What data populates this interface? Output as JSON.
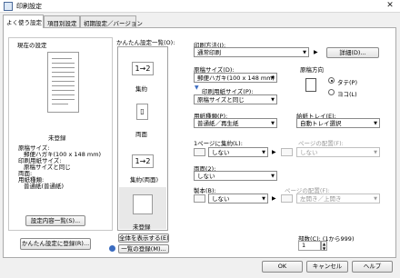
{
  "window": {
    "title": "印刷設定",
    "close_glyph": "✕"
  },
  "tabs": [
    {
      "label": "よく使う設定"
    },
    {
      "label": "項目別設定"
    },
    {
      "label": "初期設定／バージョン"
    }
  ],
  "current": {
    "heading": "現在の設定",
    "name": "未登録",
    "summary": [
      "原稿サイズ:",
      "郵便ハガキ(100 x 148 mm)",
      "印刷用紙サイズ:",
      "原稿サイズと同じ",
      "両面:",
      "用紙種類:",
      "普通紙(普通紙)"
    ],
    "list_button": "設定内容一覧(S)..."
  },
  "easy": {
    "heading": "かんたん設定一覧(O):",
    "items": [
      {
        "glyph": "1→2",
        "label": "集約"
      },
      {
        "glyph": "▯",
        "label": "両面"
      },
      {
        "glyph": "1→2",
        "label": "集約(両面)"
      },
      {
        "glyph": "",
        "label": "未登録"
      }
    ],
    "show_all_button": "全体を表示する(E)",
    "list_button": "一覧の登録(M)...",
    "register_button": "かんたん設定に登録(R)..."
  },
  "settings": {
    "method_label": "印刷方法(J):",
    "method_value": "通常印刷",
    "detail_button": "詳細(D)...",
    "orig_size_label": "原稿サイズ(D):",
    "orig_size_value": "郵便ハガキ(100 x 148 mm)",
    "paper_size_label": "印刷用紙サイズ(P):",
    "paper_size_value": "原稿サイズと同じ",
    "orientation_label": "原稿方向",
    "orientation_options": [
      {
        "label": "タテ(P)",
        "selected": true
      },
      {
        "label": "ヨコ(L)",
        "selected": false
      }
    ],
    "paper_type_label": "用紙種類(P):",
    "paper_type_value": "普通紙／再生紙",
    "tray_label": "給紙トレイ(E):",
    "tray_value": "自動トレイ選択",
    "nup_label": "1ページに集約(L):",
    "nup_value": "しない",
    "nup_order_label": "ページの配置(F):",
    "nup_order_value": "しない",
    "duplex_label": "両面(2):",
    "duplex_value": "しない",
    "booklet_label": "製本(B):",
    "booklet_value": "しない",
    "booklet_order_label": "ページの配置(F):",
    "booklet_order_value": "左開き／上開き",
    "copies_label": "部数(C): (1から999)",
    "copies_value": "1"
  },
  "footer": {
    "ok": "OK",
    "cancel": "キャンセル",
    "help": "ヘルプ"
  }
}
